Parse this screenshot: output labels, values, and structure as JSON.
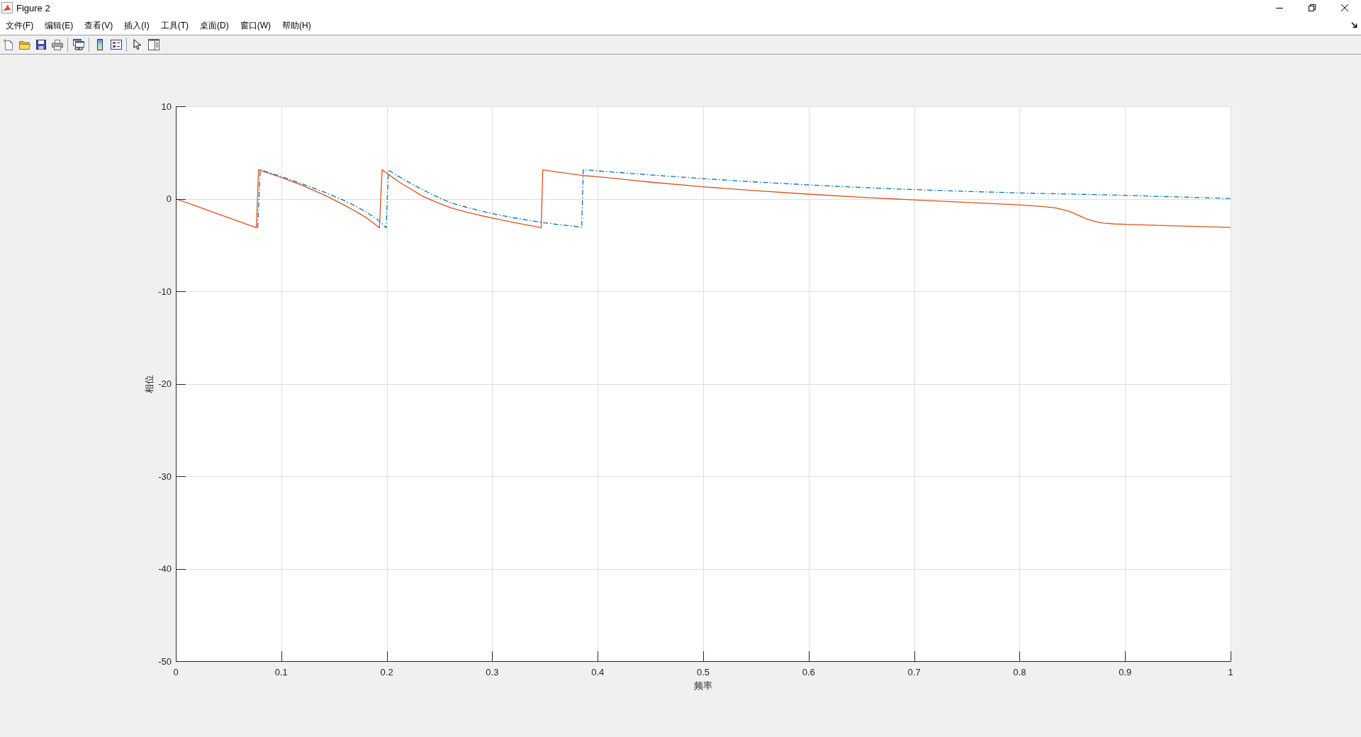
{
  "window": {
    "title": "Figure 2"
  },
  "menu_bar": [
    "文件(F)",
    "编辑(E)",
    "查看(V)",
    "插入(I)",
    "工具(T)",
    "桌面(D)",
    "窗口(W)",
    "帮助(H)"
  ],
  "axes": {
    "chart_data": {
      "type": "line",
      "xlabel": "频率",
      "ylabel": "相位",
      "grid": true,
      "x": [
        0,
        0.02,
        0.04,
        0.06,
        0.0764,
        0.0777,
        0.0785,
        0.08,
        0.1,
        0.12,
        0.14,
        0.16,
        0.17,
        0.18,
        0.187,
        0.193,
        0.1956,
        0.1994,
        0.2016,
        0.2063,
        0.213,
        0.22,
        0.2337,
        0.245,
        0.261,
        0.275,
        0.2887,
        0.3,
        0.32,
        0.3436,
        0.3464,
        0.348,
        0.36,
        0.3836,
        0.3848,
        0.3863,
        0.4,
        0.417,
        0.45,
        0.5,
        0.55,
        0.6,
        0.65,
        0.7,
        0.75,
        0.8,
        0.827,
        0.835,
        0.847,
        0.855,
        0.8633,
        0.871,
        0.8795,
        0.89,
        0.901,
        0.95,
        1
      ],
      "series": [
        {
          "color": "#0072bd",
          "line_style": "dash-dot",
          "values": [
            null,
            null,
            null,
            null,
            null,
            -3.14,
            -0.96,
            3.14,
            2.4,
            1.6,
            0.75,
            -0.2,
            -0.77,
            -1.4,
            -1.92,
            -2.4,
            -2.7,
            -3.14,
            3.14,
            2.75,
            2.3,
            1.85,
            1.0,
            0.35,
            -0.45,
            -0.9,
            -1.3,
            -1.6,
            -2.05,
            -2.5,
            -2.55,
            -2.58,
            -2.75,
            -3.05,
            -3.14,
            3.14,
            3.02,
            2.87,
            2.58,
            2.18,
            1.82,
            1.5,
            1.22,
            0.99,
            0.8,
            0.63,
            0.56,
            0.54,
            0.51,
            0.49,
            0.47,
            0.45,
            0.43,
            0.4,
            0.37,
            0.2,
            0.03
          ]
        },
        {
          "color": "#d95319",
          "line_style": "solid",
          "values": [
            0,
            -0.82,
            -1.64,
            -2.47,
            -3.14,
            0.75,
            3.14,
            3.08,
            2.3,
            1.45,
            0.45,
            -0.7,
            -1.32,
            -2.0,
            -2.58,
            -3.14,
            3.14,
            2.82,
            2.64,
            2.25,
            1.72,
            1.25,
            0.3,
            -0.28,
            -0.98,
            -1.42,
            -1.8,
            -2.08,
            -2.55,
            -3.05,
            -3.14,
            3.14,
            2.92,
            2.55,
            2.53,
            2.51,
            2.38,
            2.2,
            1.8,
            1.3,
            0.87,
            0.5,
            0.17,
            -0.13,
            -0.4,
            -0.66,
            -0.89,
            -1.0,
            -1.35,
            -1.75,
            -2.18,
            -2.45,
            -2.64,
            -2.72,
            -2.77,
            -2.94,
            -3.1
          ]
        }
      ],
      "xlim": [
        0,
        1
      ],
      "ylim": [
        -50,
        10
      ],
      "xticks": [
        0,
        0.1,
        0.2,
        0.3,
        0.4,
        0.5,
        0.6,
        0.7,
        0.8,
        0.9,
        1
      ],
      "yticks": [
        -50,
        -40,
        -30,
        -20,
        -10,
        0,
        10
      ]
    }
  }
}
